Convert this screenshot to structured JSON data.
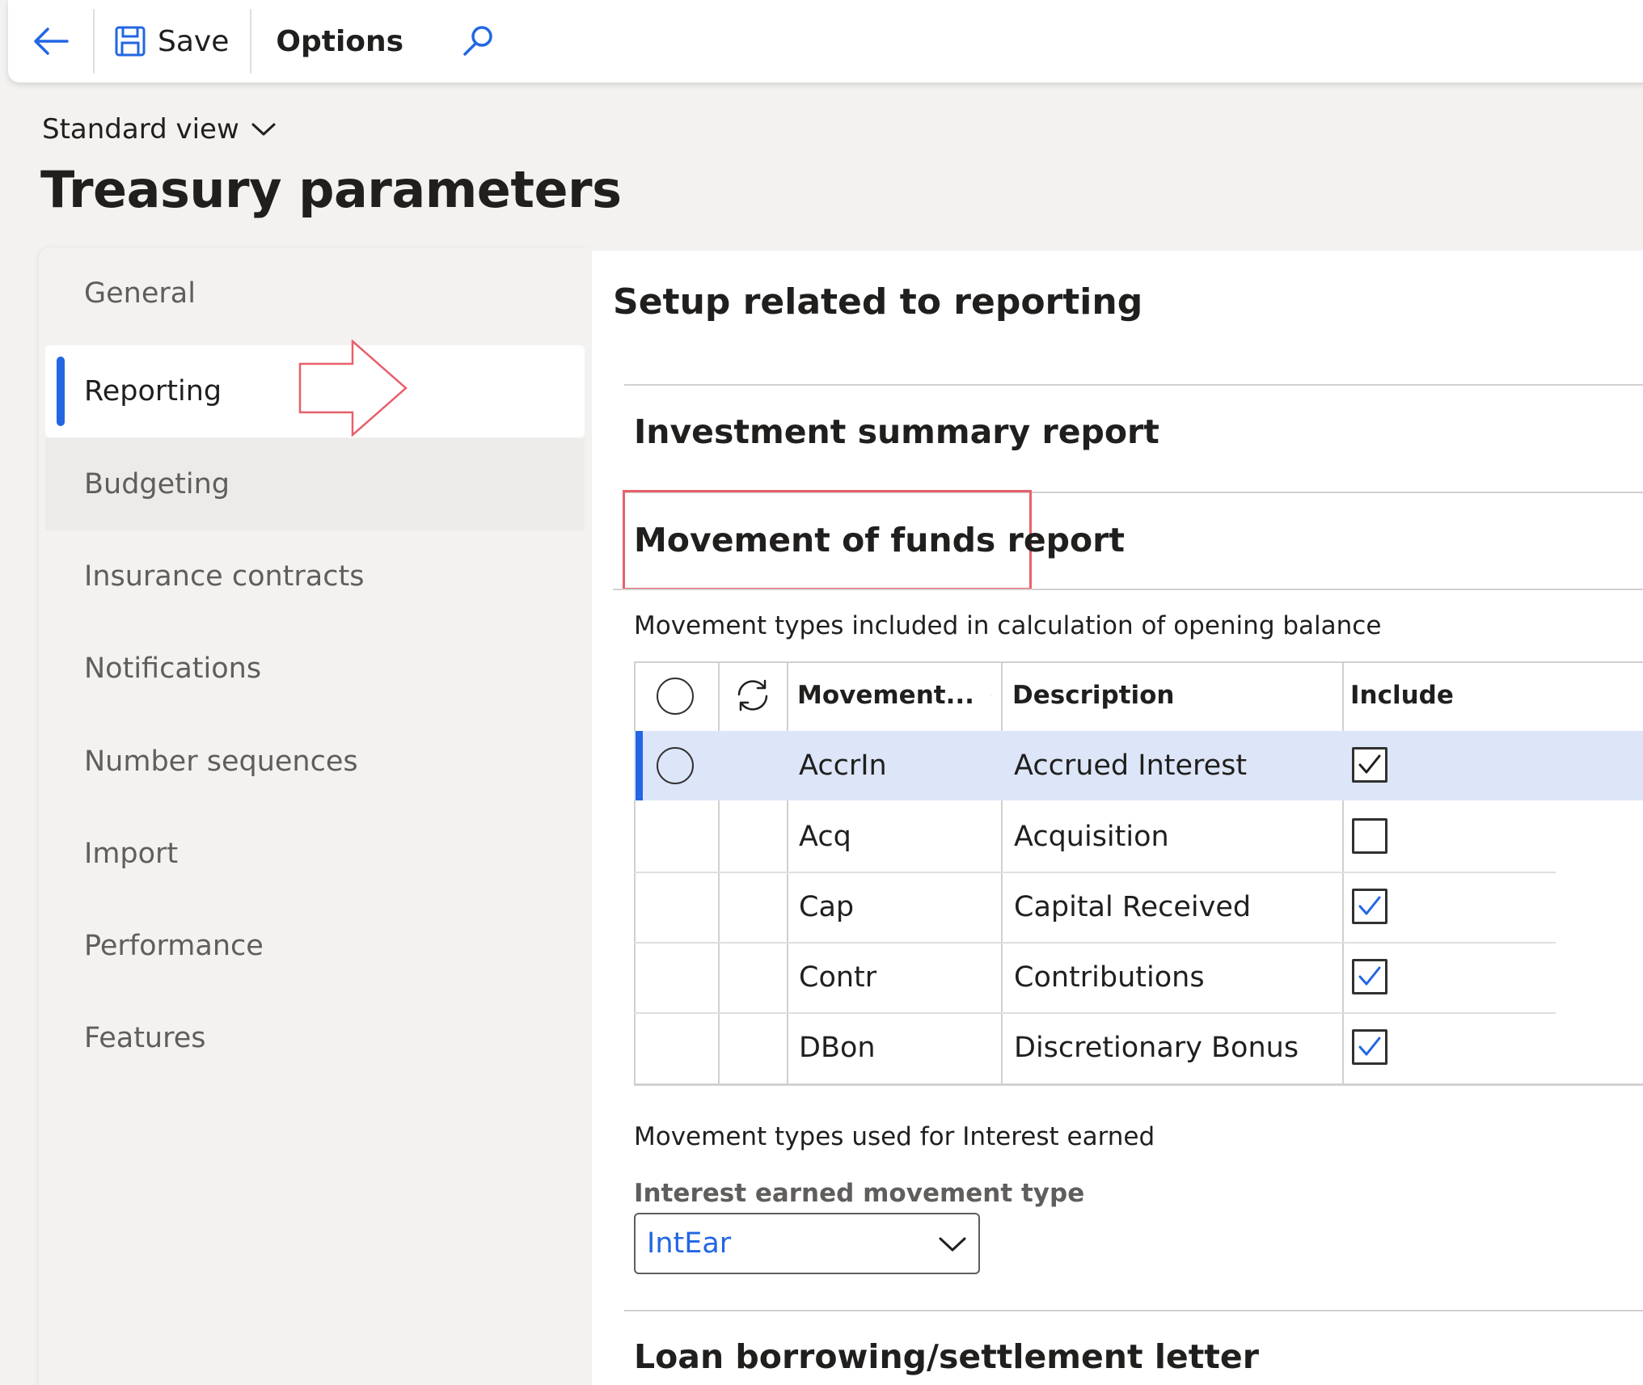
{
  "toolbar": {
    "back_icon": "back-arrow-icon",
    "save_icon": "floppy-disk-icon",
    "save_label": "Save",
    "options_label": "Options",
    "search_icon": "search-icon"
  },
  "header": {
    "view_label": "Standard view",
    "title": "Treasury parameters"
  },
  "leftnav": {
    "items": [
      {
        "label": "General"
      },
      {
        "label": "Reporting"
      },
      {
        "label": "Budgeting"
      },
      {
        "label": "Insurance contracts"
      },
      {
        "label": "Notifications"
      },
      {
        "label": "Number sequences"
      },
      {
        "label": "Import"
      },
      {
        "label": "Performance"
      },
      {
        "label": "Features"
      }
    ],
    "active_index": 1
  },
  "main": {
    "title": "Setup related to reporting",
    "section_investment": "Investment summary report",
    "section_movement": "Movement of funds report",
    "movement_types_label": "Movement types included in calculation of opening balance",
    "grid": {
      "columns": {
        "movement": "Movement...",
        "description": "Description",
        "include": "Include"
      },
      "rows": [
        {
          "movement": "AccrIn",
          "description": "Accrued Interest",
          "include": true,
          "selected": true
        },
        {
          "movement": "Acq",
          "description": "Acquisition",
          "include": false,
          "selected": false
        },
        {
          "movement": "Cap",
          "description": "Capital Received",
          "include": true,
          "selected": false
        },
        {
          "movement": "Contr",
          "description": "Contributions",
          "include": true,
          "selected": false
        },
        {
          "movement": "DBon",
          "description": "Discretionary Bonus",
          "include": true,
          "selected": false
        }
      ]
    },
    "interest_label": "Movement types used for Interest earned",
    "interest_field_label": "Interest earned movement type",
    "interest_field_value": "IntEar",
    "section_loan": "Loan borrowing/settlement letter"
  },
  "colors": {
    "accent": "#2266e3",
    "annotation_red": "#e8606b",
    "selected_row": "#dde6f8"
  }
}
